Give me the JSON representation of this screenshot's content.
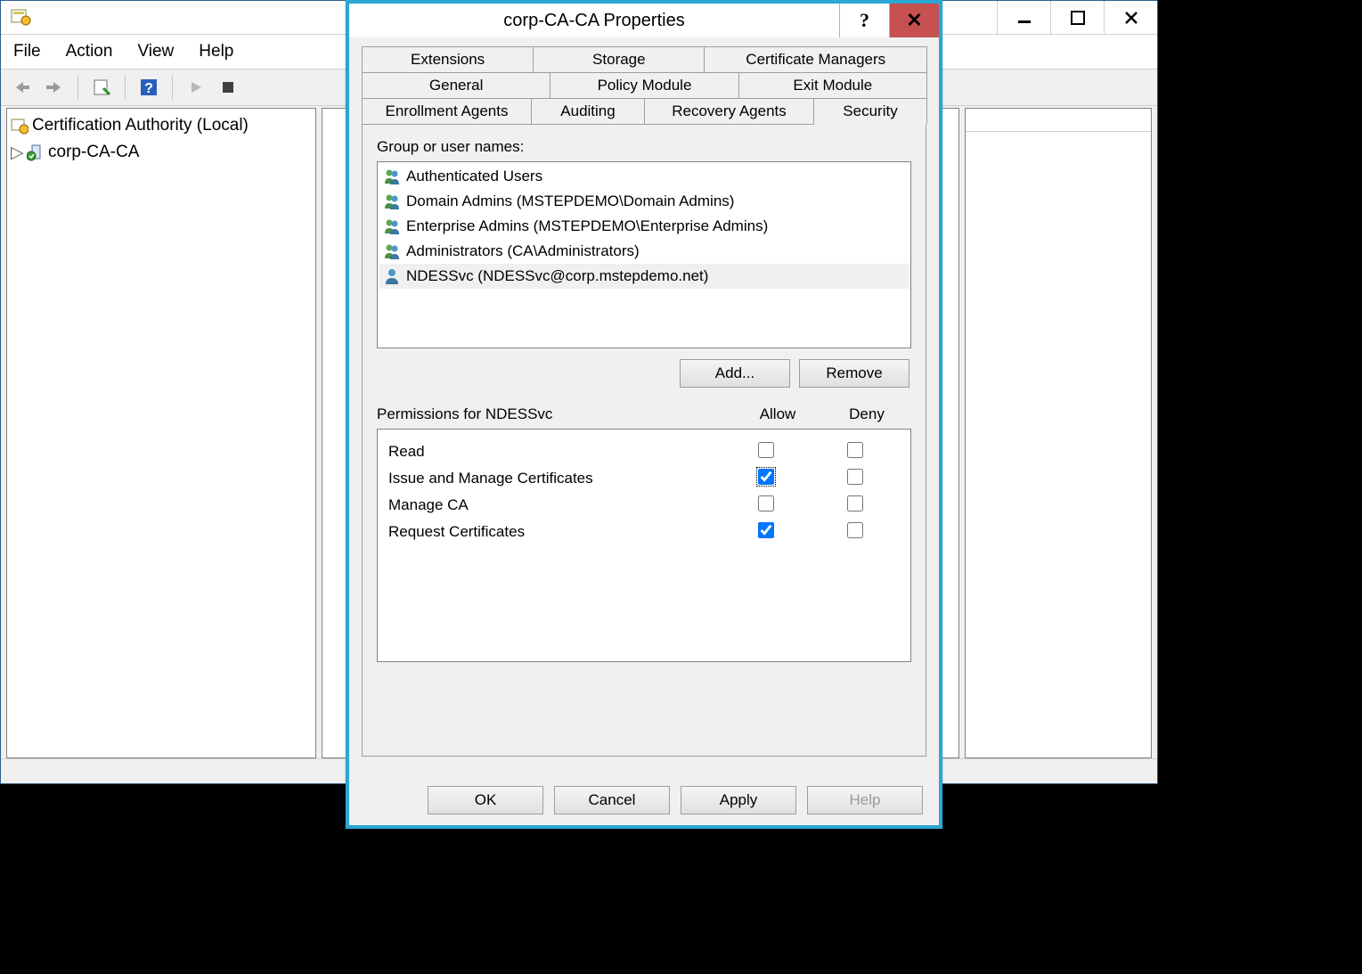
{
  "mmc": {
    "menu": {
      "file": "File",
      "action": "Action",
      "view": "View",
      "help": "Help"
    },
    "tree": {
      "root": "Certification Authority (Local)",
      "node": "corp-CA-CA"
    }
  },
  "dialog": {
    "title": "corp-CA-CA Properties",
    "tabs": {
      "extensions": "Extensions",
      "storage": "Storage",
      "certmgrs": "Certificate Managers",
      "general": "General",
      "policy": "Policy Module",
      "exit": "Exit Module",
      "enrollment": "Enrollment Agents",
      "auditing": "Auditing",
      "recovery": "Recovery Agents",
      "security": "Security"
    },
    "group_label": "Group or user names:",
    "groups": [
      "Authenticated Users",
      "Domain Admins (MSTEPDEMO\\Domain Admins)",
      "Enterprise Admins (MSTEPDEMO\\Enterprise Admins)",
      "Administrators (CA\\Administrators)",
      "NDESSvc (NDESSvc@corp.mstepdemo.net)"
    ],
    "btn_add": "Add...",
    "btn_remove": "Remove",
    "perm_label": "Permissions for NDESSvc",
    "col_allow": "Allow",
    "col_deny": "Deny",
    "perms": [
      {
        "name": "Read",
        "allow": false,
        "deny": false
      },
      {
        "name": "Issue and Manage Certificates",
        "allow": true,
        "deny": false,
        "focused": true
      },
      {
        "name": "Manage CA",
        "allow": false,
        "deny": false
      },
      {
        "name": "Request Certificates",
        "allow": true,
        "deny": false
      }
    ],
    "btn_ok": "OK",
    "btn_cancel": "Cancel",
    "btn_apply": "Apply",
    "btn_help": "Help"
  }
}
